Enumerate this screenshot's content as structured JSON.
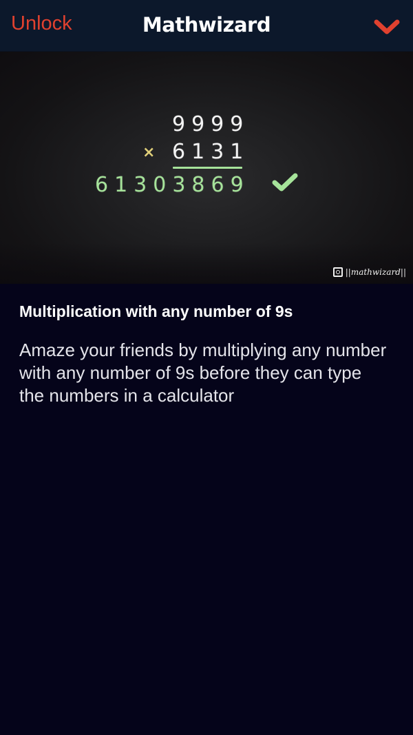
{
  "header": {
    "unlock_label": "Unlock",
    "title": "Mathwizard",
    "collapse_icon": "chevron-down-icon",
    "accent_color": "#e0412f"
  },
  "hero": {
    "multiplicand": "9999",
    "operator": "×",
    "multiplier": "6131",
    "result": "61303869",
    "result_status_icon": "checkmark-icon",
    "watermark_icon": "instagram-icon",
    "watermark_text": "||mathwizard||",
    "chalk_green": "#a6e39a"
  },
  "content": {
    "heading": "Multiplication with any number of 9s",
    "description": "Amaze your friends by multiplying any number with any number of 9s  before they can type the numbers in a calculator"
  }
}
